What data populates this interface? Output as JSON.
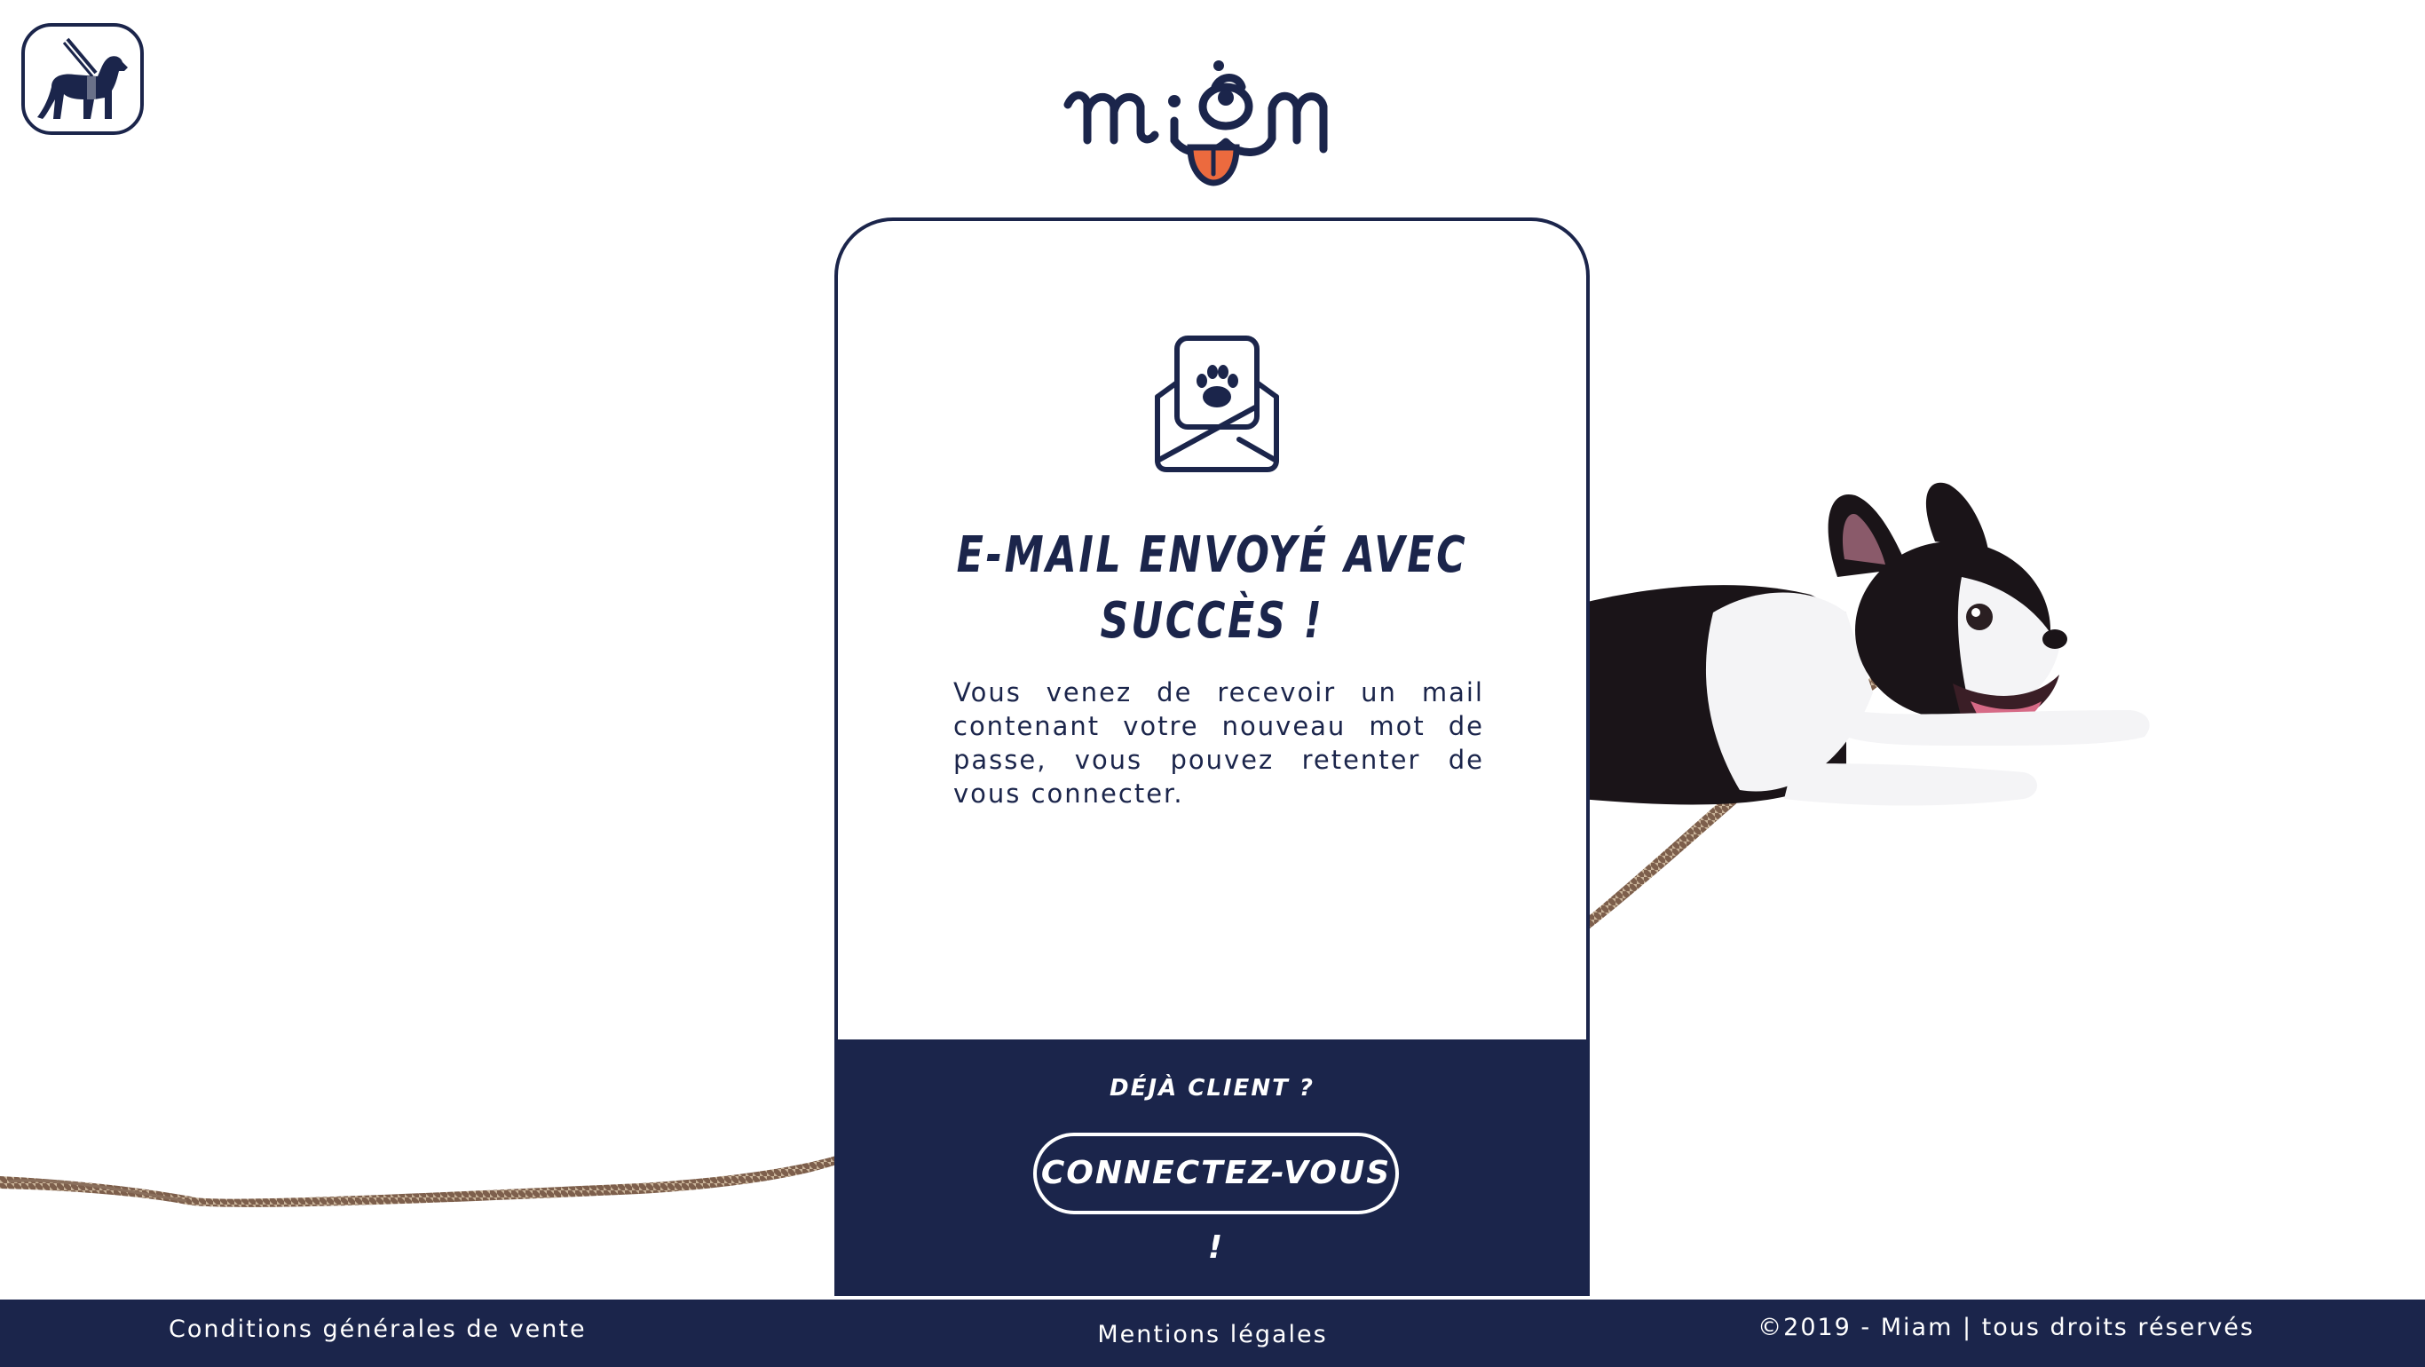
{
  "brand": {
    "logo_text": "miam",
    "navy": "#1b254b",
    "accent_orange": "#ec6a3e"
  },
  "accessibility": {
    "icon": "guide-dog-icon"
  },
  "card": {
    "icon": "envelope-paw-icon",
    "title": "E-MAIL ENVOYÉ AVEC SUCCÈS !",
    "message": "Vous venez de recevoir un mail contenant votre nouveau mot de passe, vous pouvez retenter de vous connecter.",
    "already_client": "DÉJÀ CLIENT ?",
    "connect_label": "CONNECTEZ-VOUS !"
  },
  "footer": {
    "cgv": "Conditions générales de vente",
    "mentions": "Mentions légales",
    "copyright": "©2019 - Miam | tous droits réservés"
  }
}
